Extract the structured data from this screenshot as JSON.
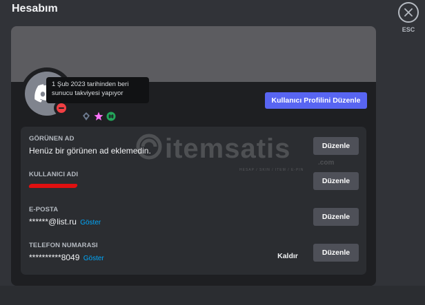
{
  "header": {
    "title": "Hesabım"
  },
  "close": {
    "label": "ESC",
    "icon": "close-icon"
  },
  "profile": {
    "edit_profile_label": "Kullanıcı Profilini Düzenle",
    "tooltip": "1 Şub 2023 tarihinden beri sunucu takviyesi yapıyor",
    "status": "dnd",
    "badges": [
      "boost-gem-badge",
      "nitro-badge",
      "quest-badge"
    ]
  },
  "fields": {
    "display_name": {
      "label": "GÖRÜNEN AD",
      "value": "Henüz bir görünen ad eklemedin.",
      "button": "Düzenle"
    },
    "username": {
      "label": "KULLANICI ADI",
      "value": "",
      "button": "Düzenle"
    },
    "email": {
      "label": "E-POSTA",
      "value": "******@list.ru",
      "reveal": "Göster",
      "button": "Düzenle"
    },
    "phone": {
      "label": "TELEFON NUMARASI",
      "value": "**********8049",
      "reveal": "Göster",
      "remove": "Kaldır",
      "button": "Düzenle"
    }
  },
  "watermark": {
    "brand": "itemsatis",
    "suffix": ".com",
    "tagline": "HESAP / SKIN / ITEM / E-PIN"
  },
  "colors": {
    "background": "#313338",
    "card": "#1e1f22",
    "fields_panel": "#2b2d31",
    "accent": "#5865f2",
    "link": "#00a8fc",
    "dnd": "#f23f43"
  }
}
